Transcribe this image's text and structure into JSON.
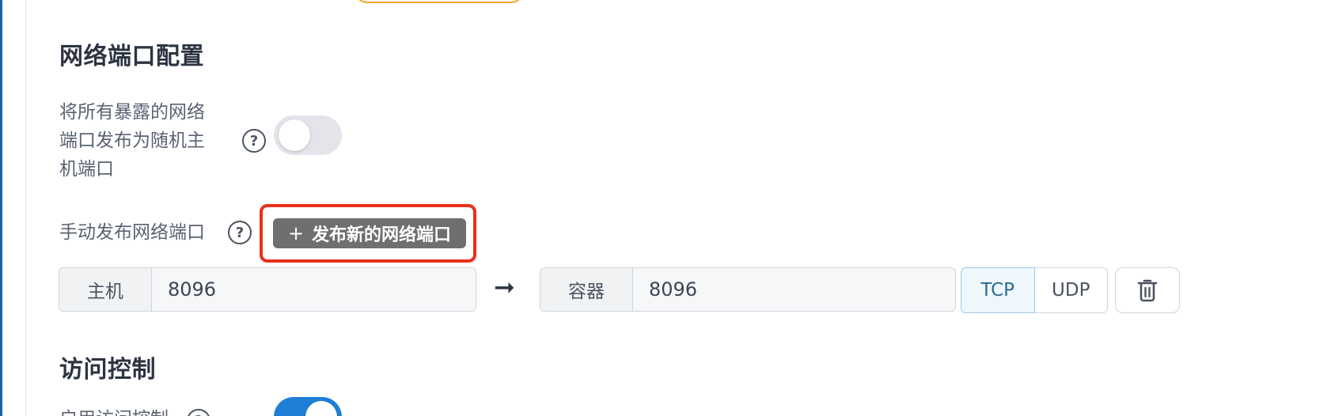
{
  "network_ports": {
    "title": "网络端口配置",
    "publish_all": {
      "label_line1": "将所有暴露的网络",
      "label_line2": "端口发布为随机主",
      "label_line3": "机端口",
      "help": "?",
      "enabled": false
    },
    "manual_publish": {
      "label": "手动发布网络端口",
      "help": "?",
      "add_button_label": "发布新的网络端口",
      "add_button_icon": "plus-icon"
    },
    "mappings": [
      {
        "host_label": "主机",
        "host_port": "8096",
        "arrow": "➞",
        "container_label": "容器",
        "container_port": "8096",
        "protocols": [
          "TCP",
          "UDP"
        ],
        "selected_protocol": "TCP",
        "delete_icon": "trash-icon"
      }
    ]
  },
  "access_control": {
    "title": "访问控制",
    "enable_label": "启用访问控制",
    "enabled": true
  },
  "colors": {
    "highlight_border": "#e8301c",
    "toggle_on": "#1f7fd6",
    "toggle_off": "#e3e5ea",
    "button_bg": "#6f6f6f",
    "left_accent": "#1565a8",
    "top_tab_border": "#f5a623"
  }
}
